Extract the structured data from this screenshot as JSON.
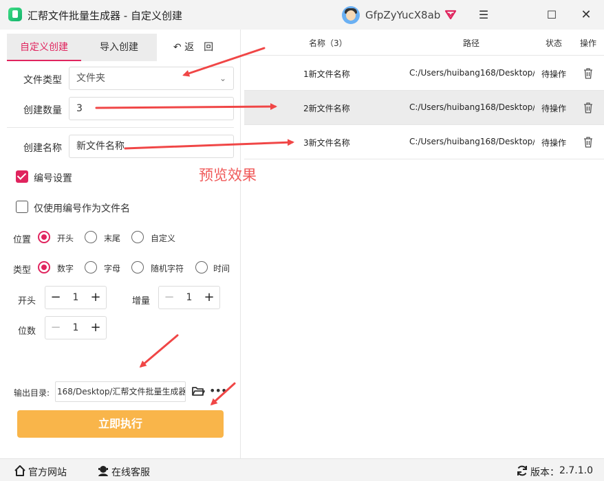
{
  "window": {
    "title": "汇帮文件批量生成器 - 自定义创建",
    "username": "GfpZyYucX8ab",
    "menu_glyph": "☰",
    "maximize_glyph": "☐",
    "close_glyph": "✕"
  },
  "tabs": {
    "custom": "自定义创建",
    "import": "导入创建",
    "back": "↶ 返　回"
  },
  "form": {
    "file_type_label": "文件类型",
    "file_type_value": "文件夹",
    "count_label": "创建数量",
    "count_value": "3",
    "name_label": "创建名称",
    "name_value": "新文件名称"
  },
  "numbering": {
    "enabled_label": "编号设置",
    "only_number_label": "仅使用编号作为文件名",
    "position_label": "位置",
    "position_options": [
      "开头",
      "末尾",
      "自定义"
    ],
    "position_selected": "开头",
    "type_label": "类型",
    "type_options": [
      "数字",
      "字母",
      "随机字符",
      "时间"
    ],
    "type_selected": "数字",
    "start_label": "开头",
    "start_value": "1",
    "increment_label": "增量",
    "increment_value": "1",
    "digits_label": "位数",
    "digits_value": "1",
    "minus_glyph": "−",
    "plus_glyph": "+"
  },
  "output": {
    "label": "输出目录:",
    "path": "168/Desktop/汇帮文件批量生成器",
    "more_glyph": "•••"
  },
  "run_button": "立即执行",
  "table": {
    "headers": {
      "name": "名称（3）",
      "path": "路径",
      "status": "状态",
      "action": "操作"
    },
    "rows": [
      {
        "name": "1新文件名称",
        "path": "C:/Users/huibang168/Desktop/",
        "status": "待操作"
      },
      {
        "name": "2新文件名称",
        "path": "C:/Users/huibang168/Desktop/",
        "status": "待操作"
      },
      {
        "name": "3新文件名称",
        "path": "C:/Users/huibang168/Desktop/",
        "status": "待操作"
      }
    ]
  },
  "annotation": {
    "preview_text": "预览效果",
    "arrow_color": "#f04646"
  },
  "footer": {
    "website": "官方网站",
    "support": "在线客服",
    "version_label": "版本：",
    "version_value": "2.7.1.0"
  },
  "colors": {
    "accent": "#e0245e",
    "run_button": "#f9b54a",
    "preview_text": "#f05a5a"
  },
  "icons": [
    "app-logo-icon",
    "avatar",
    "vip-icon",
    "menu-icon",
    "maximize-icon",
    "close-icon",
    "chevron-down-icon",
    "checkbox-icon",
    "folder-icon",
    "more-icon",
    "trash-icon",
    "home-icon",
    "support-icon",
    "refresh-icon"
  ]
}
